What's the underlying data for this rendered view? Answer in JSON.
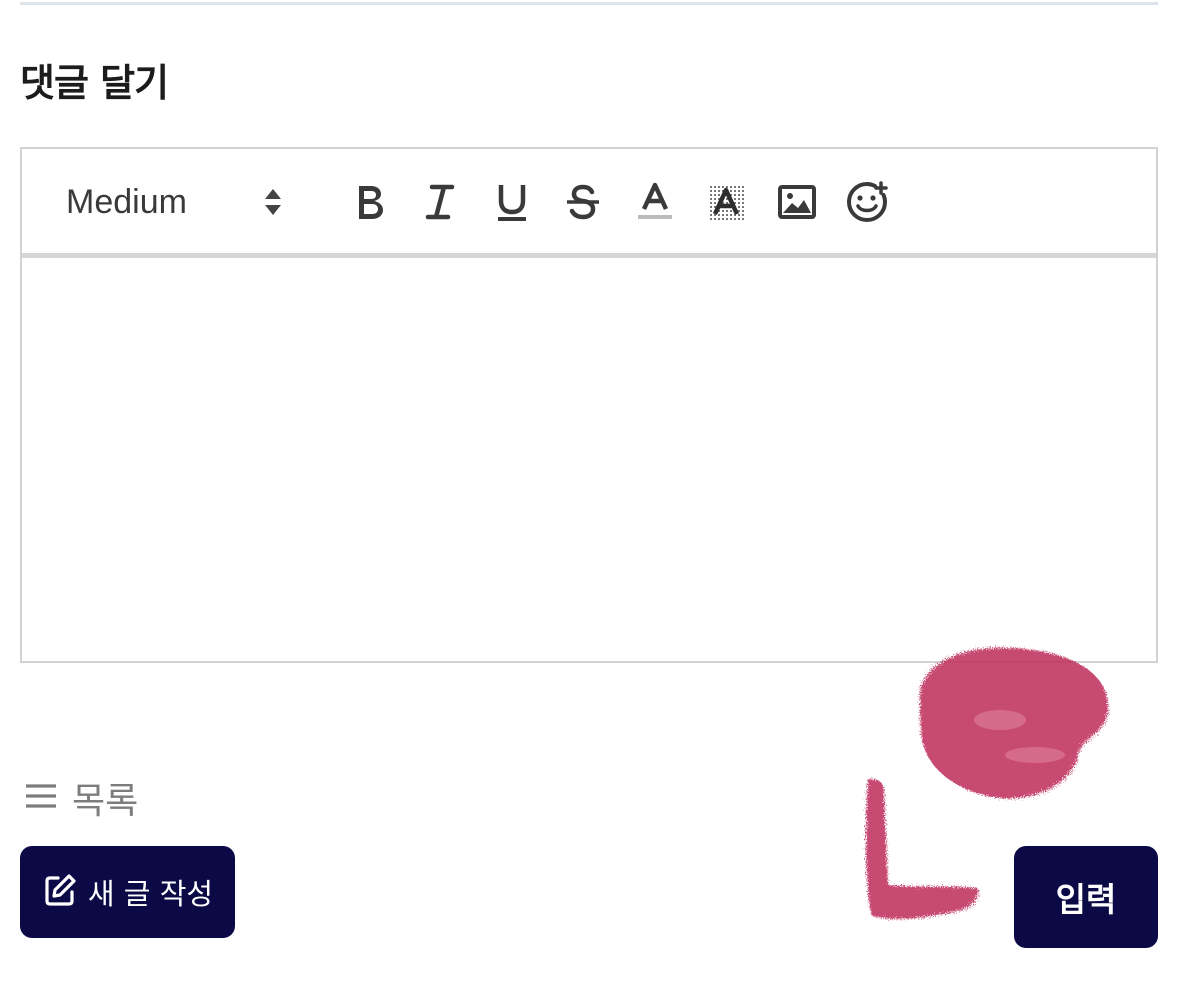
{
  "comment_section": {
    "title": "댓글 달기"
  },
  "toolbar": {
    "font_size": "Medium",
    "icons": {
      "size_arrows": "up-down-arrows-icon",
      "bold": "bold-icon",
      "italic": "italic-icon",
      "underline": "underline-icon",
      "strikethrough": "strikethrough-icon",
      "font_color": "font-color-icon",
      "highlight": "background-color-icon",
      "image": "image-icon",
      "emoji": "emoji-add-icon"
    }
  },
  "editor": {
    "content": ""
  },
  "footer": {
    "list_label": "목록",
    "new_post_label": "새 글 작성",
    "submit_label": "입력"
  },
  "colors": {
    "button_bg": "#0b0a47",
    "scribble": "#c0335f",
    "border": "#d2d2d2"
  }
}
